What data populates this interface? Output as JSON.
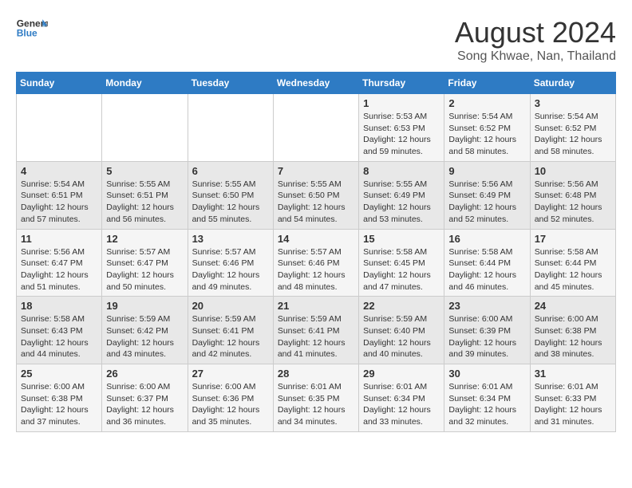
{
  "logo": {
    "line1": "General",
    "line2": "Blue"
  },
  "title": "August 2024",
  "subtitle": "Song Khwae, Nan, Thailand",
  "weekdays": [
    "Sunday",
    "Monday",
    "Tuesday",
    "Wednesday",
    "Thursday",
    "Friday",
    "Saturday"
  ],
  "weeks": [
    [
      {
        "day": "",
        "info": ""
      },
      {
        "day": "",
        "info": ""
      },
      {
        "day": "",
        "info": ""
      },
      {
        "day": "",
        "info": ""
      },
      {
        "day": "1",
        "sunrise": "Sunrise: 5:53 AM",
        "sunset": "Sunset: 6:53 PM",
        "daylight": "Daylight: 12 hours and 59 minutes."
      },
      {
        "day": "2",
        "sunrise": "Sunrise: 5:54 AM",
        "sunset": "Sunset: 6:52 PM",
        "daylight": "Daylight: 12 hours and 58 minutes."
      },
      {
        "day": "3",
        "sunrise": "Sunrise: 5:54 AM",
        "sunset": "Sunset: 6:52 PM",
        "daylight": "Daylight: 12 hours and 58 minutes."
      }
    ],
    [
      {
        "day": "4",
        "sunrise": "Sunrise: 5:54 AM",
        "sunset": "Sunset: 6:51 PM",
        "daylight": "Daylight: 12 hours and 57 minutes."
      },
      {
        "day": "5",
        "sunrise": "Sunrise: 5:55 AM",
        "sunset": "Sunset: 6:51 PM",
        "daylight": "Daylight: 12 hours and 56 minutes."
      },
      {
        "day": "6",
        "sunrise": "Sunrise: 5:55 AM",
        "sunset": "Sunset: 6:50 PM",
        "daylight": "Daylight: 12 hours and 55 minutes."
      },
      {
        "day": "7",
        "sunrise": "Sunrise: 5:55 AM",
        "sunset": "Sunset: 6:50 PM",
        "daylight": "Daylight: 12 hours and 54 minutes."
      },
      {
        "day": "8",
        "sunrise": "Sunrise: 5:55 AM",
        "sunset": "Sunset: 6:49 PM",
        "daylight": "Daylight: 12 hours and 53 minutes."
      },
      {
        "day": "9",
        "sunrise": "Sunrise: 5:56 AM",
        "sunset": "Sunset: 6:49 PM",
        "daylight": "Daylight: 12 hours and 52 minutes."
      },
      {
        "day": "10",
        "sunrise": "Sunrise: 5:56 AM",
        "sunset": "Sunset: 6:48 PM",
        "daylight": "Daylight: 12 hours and 52 minutes."
      }
    ],
    [
      {
        "day": "11",
        "sunrise": "Sunrise: 5:56 AM",
        "sunset": "Sunset: 6:47 PM",
        "daylight": "Daylight: 12 hours and 51 minutes."
      },
      {
        "day": "12",
        "sunrise": "Sunrise: 5:57 AM",
        "sunset": "Sunset: 6:47 PM",
        "daylight": "Daylight: 12 hours and 50 minutes."
      },
      {
        "day": "13",
        "sunrise": "Sunrise: 5:57 AM",
        "sunset": "Sunset: 6:46 PM",
        "daylight": "Daylight: 12 hours and 49 minutes."
      },
      {
        "day": "14",
        "sunrise": "Sunrise: 5:57 AM",
        "sunset": "Sunset: 6:46 PM",
        "daylight": "Daylight: 12 hours and 48 minutes."
      },
      {
        "day": "15",
        "sunrise": "Sunrise: 5:58 AM",
        "sunset": "Sunset: 6:45 PM",
        "daylight": "Daylight: 12 hours and 47 minutes."
      },
      {
        "day": "16",
        "sunrise": "Sunrise: 5:58 AM",
        "sunset": "Sunset: 6:44 PM",
        "daylight": "Daylight: 12 hours and 46 minutes."
      },
      {
        "day": "17",
        "sunrise": "Sunrise: 5:58 AM",
        "sunset": "Sunset: 6:44 PM",
        "daylight": "Daylight: 12 hours and 45 minutes."
      }
    ],
    [
      {
        "day": "18",
        "sunrise": "Sunrise: 5:58 AM",
        "sunset": "Sunset: 6:43 PM",
        "daylight": "Daylight: 12 hours and 44 minutes."
      },
      {
        "day": "19",
        "sunrise": "Sunrise: 5:59 AM",
        "sunset": "Sunset: 6:42 PM",
        "daylight": "Daylight: 12 hours and 43 minutes."
      },
      {
        "day": "20",
        "sunrise": "Sunrise: 5:59 AM",
        "sunset": "Sunset: 6:41 PM",
        "daylight": "Daylight: 12 hours and 42 minutes."
      },
      {
        "day": "21",
        "sunrise": "Sunrise: 5:59 AM",
        "sunset": "Sunset: 6:41 PM",
        "daylight": "Daylight: 12 hours and 41 minutes."
      },
      {
        "day": "22",
        "sunrise": "Sunrise: 5:59 AM",
        "sunset": "Sunset: 6:40 PM",
        "daylight": "Daylight: 12 hours and 40 minutes."
      },
      {
        "day": "23",
        "sunrise": "Sunrise: 6:00 AM",
        "sunset": "Sunset: 6:39 PM",
        "daylight": "Daylight: 12 hours and 39 minutes."
      },
      {
        "day": "24",
        "sunrise": "Sunrise: 6:00 AM",
        "sunset": "Sunset: 6:38 PM",
        "daylight": "Daylight: 12 hours and 38 minutes."
      }
    ],
    [
      {
        "day": "25",
        "sunrise": "Sunrise: 6:00 AM",
        "sunset": "Sunset: 6:38 PM",
        "daylight": "Daylight: 12 hours and 37 minutes."
      },
      {
        "day": "26",
        "sunrise": "Sunrise: 6:00 AM",
        "sunset": "Sunset: 6:37 PM",
        "daylight": "Daylight: 12 hours and 36 minutes."
      },
      {
        "day": "27",
        "sunrise": "Sunrise: 6:00 AM",
        "sunset": "Sunset: 6:36 PM",
        "daylight": "Daylight: 12 hours and 35 minutes."
      },
      {
        "day": "28",
        "sunrise": "Sunrise: 6:01 AM",
        "sunset": "Sunset: 6:35 PM",
        "daylight": "Daylight: 12 hours and 34 minutes."
      },
      {
        "day": "29",
        "sunrise": "Sunrise: 6:01 AM",
        "sunset": "Sunset: 6:34 PM",
        "daylight": "Daylight: 12 hours and 33 minutes."
      },
      {
        "day": "30",
        "sunrise": "Sunrise: 6:01 AM",
        "sunset": "Sunset: 6:34 PM",
        "daylight": "Daylight: 12 hours and 32 minutes."
      },
      {
        "day": "31",
        "sunrise": "Sunrise: 6:01 AM",
        "sunset": "Sunset: 6:33 PM",
        "daylight": "Daylight: 12 hours and 31 minutes."
      }
    ]
  ]
}
